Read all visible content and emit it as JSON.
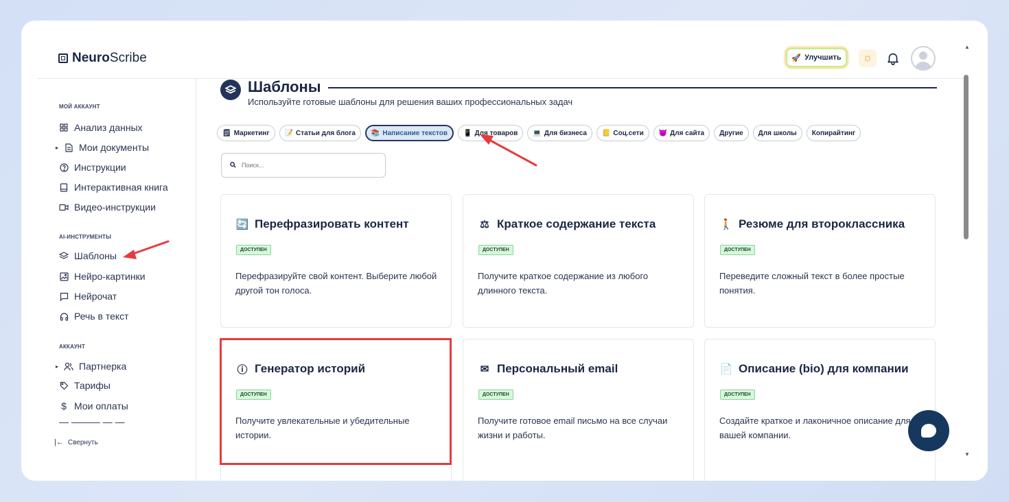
{
  "header": {
    "logo_bold": "Neuro",
    "logo_rest": "Scribe",
    "upgrade_label": "Улучшить"
  },
  "sidebar": {
    "section_account": "МОЙ АККАУНТ",
    "account_items": [
      {
        "label": "Анализ данных",
        "icon": "grid-icon"
      },
      {
        "label": "Мои документы",
        "icon": "document-icon"
      },
      {
        "label": "Инструкции",
        "icon": "help-icon"
      },
      {
        "label": "Интерактивная книга",
        "icon": "book-icon"
      },
      {
        "label": "Видео-инструкции",
        "icon": "video-icon"
      }
    ],
    "section_ai": "AI-ИНСТРУМЕНТЫ",
    "ai_items": [
      {
        "label": "Шаблоны",
        "icon": "layers-icon"
      },
      {
        "label": "Нейро-картинки",
        "icon": "image-icon"
      },
      {
        "label": "Нейрочат",
        "icon": "chat-icon"
      },
      {
        "label": "Речь в текст",
        "icon": "headphones-icon"
      }
    ],
    "section_profile": "АККАУНТ",
    "profile_items": [
      {
        "label": "Партнерка",
        "icon": "users-icon"
      },
      {
        "label": "Тарифы",
        "icon": "tag-icon"
      },
      {
        "label": "Мои оплаты",
        "icon": "dollar-icon"
      }
    ],
    "collapse_label": "Свернуть"
  },
  "main": {
    "title": "Шаблоны",
    "subtitle": "Используйте готовые шаблоны для решения ваших профессиональных задач",
    "categories": [
      {
        "label": "Маркетинг",
        "icon": "🗒"
      },
      {
        "label": "Статьи для блога",
        "icon": "📝"
      },
      {
        "label": "Написание текстов",
        "icon": "📚"
      },
      {
        "label": "Для товаров",
        "icon": "📱"
      },
      {
        "label": "Для бизнеса",
        "icon": "💻"
      },
      {
        "label": "Соц.сети",
        "icon": "📒"
      },
      {
        "label": "Для сайта",
        "icon": "😈"
      },
      {
        "label": "Другие",
        "icon": ""
      },
      {
        "label": "Для школы",
        "icon": ""
      },
      {
        "label": "Копирайтинг",
        "icon": ""
      }
    ],
    "active_category": "Написание текстов",
    "search_placeholder": "Поиск...",
    "cards": [
      {
        "title": "Перефразировать контент",
        "icon": "🔄",
        "badge": "ДОСТУПЕН",
        "desc": "Перефразируйте свой контент. Выберите любой другой тон голоса."
      },
      {
        "title": "Краткое содержание текста",
        "icon": "⚖",
        "badge": "ДОСТУПЕН",
        "desc": "Получите краткое содержание из любого длинного текста."
      },
      {
        "title": "Резюме для второклассника",
        "icon": "🚶",
        "badge": "ДОСТУПЕН",
        "desc": "Переведите сложный текст в более простые понятия."
      },
      {
        "title": "Генератор историй",
        "icon": "ⓘ",
        "badge": "ДОСТУПЕН",
        "desc": "Получите увлекательные и убедительные истории."
      },
      {
        "title": "Персональный email",
        "icon": "✉",
        "badge": "ДОСТУПЕН",
        "desc": "Получите готовое email письмо на все случаи жизни и работы."
      },
      {
        "title": "Описание (bio) для компании",
        "icon": "📄",
        "badge": "ДОСТУПЕН",
        "desc": "Создайте краткое и лаконичное описание для вашей компании."
      }
    ]
  },
  "colors": {
    "navy": "#1a2744",
    "annotation_red": "#e8393d",
    "badge_green": "#d7f7dc"
  }
}
